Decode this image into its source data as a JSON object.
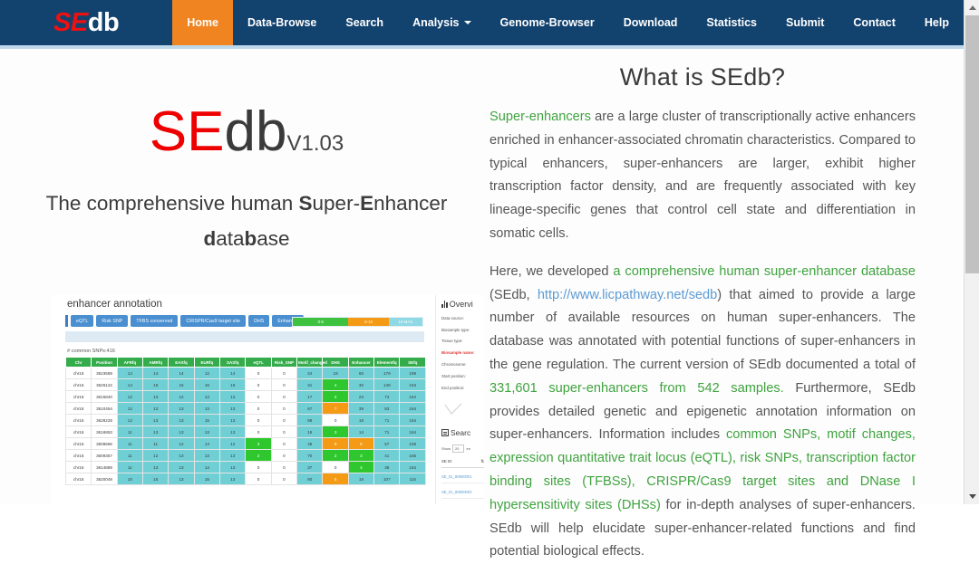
{
  "navbar": {
    "logo": {
      "part1": "SE",
      "part2": "db"
    },
    "items": [
      {
        "label": "Home",
        "active": true,
        "caret": false
      },
      {
        "label": "Data-Browse",
        "active": false,
        "caret": false
      },
      {
        "label": "Search",
        "active": false,
        "caret": false
      },
      {
        "label": "Analysis",
        "active": false,
        "caret": true
      },
      {
        "label": "Genome-Browser",
        "active": false,
        "caret": false
      },
      {
        "label": "Download",
        "active": false,
        "caret": false
      },
      {
        "label": "Statistics",
        "active": false,
        "caret": false
      },
      {
        "label": "Submit",
        "active": false,
        "caret": false
      },
      {
        "label": "Contact",
        "active": false,
        "caret": false
      },
      {
        "label": "Help",
        "active": false,
        "caret": false
      }
    ]
  },
  "brand": {
    "se": "SE",
    "db": "db",
    "version": "V1.03",
    "tagline_line1_a": "The comprehensive human ",
    "tagline_line1_b": "S",
    "tagline_line1_c": "uper-",
    "tagline_line1_d": "E",
    "tagline_line1_e": "nhancer",
    "tagline_line2_a": "d",
    "tagline_line2_b": "ata",
    "tagline_line2_c": "b",
    "tagline_line2_d": "ase"
  },
  "screenshot": {
    "heading": "enhancer annotation",
    "tabs": [
      "eQTL",
      "Risk SNP",
      "TFBS conserved",
      "CRISPR/Cas9 target site",
      "DHS",
      "Enhancer"
    ],
    "legend": [
      "0-5",
      "5-10",
      "10-MAX"
    ],
    "note": "# common SNPs:416",
    "table_headers": [
      "Chr",
      "Position",
      "AFRfq",
      "AMRfq",
      "EASfq",
      "EURfq",
      "SASfq",
      "eQTL",
      "Risk_SNP",
      "Motif_changed",
      "DHS",
      "Enhancer",
      "Elementfq",
      "SEfq"
    ],
    "table_rows": [
      [
        "chr16",
        "3623589",
        "14",
        "14",
        "14",
        "12",
        "14",
        "0",
        "0",
        "24",
        "19",
        "60",
        "179",
        "199"
      ],
      [
        "chr16",
        "3626122",
        "14",
        "16",
        "15",
        "16",
        "16",
        "0",
        "0",
        "31",
        "4",
        "30",
        "149",
        "153"
      ],
      [
        "chr16",
        "3615840",
        "12",
        "13",
        "12",
        "14",
        "13",
        "0",
        "0",
        "17",
        "4",
        "23",
        "74",
        "164"
      ],
      [
        "chr16",
        "3610454",
        "12",
        "13",
        "13",
        "13",
        "13",
        "0",
        "0",
        "67",
        "7",
        "39",
        "83",
        "164"
      ],
      [
        "chr16",
        "3628228",
        "12",
        "13",
        "13",
        "15",
        "13",
        "0",
        "0",
        "88",
        "0",
        "18",
        "71",
        "164"
      ],
      [
        "chr16",
        "3616853",
        "11",
        "13",
        "13",
        "13",
        "13",
        "0",
        "0",
        "19",
        "3",
        "14",
        "71",
        "164"
      ],
      [
        "chr16",
        "3608686",
        "11",
        "11",
        "12",
        "14",
        "12",
        "3",
        "0",
        "48",
        "9",
        "6",
        "57",
        "169"
      ],
      [
        "chr16",
        "3609357",
        "11",
        "12",
        "13",
        "13",
        "13",
        "2",
        "0",
        "70",
        "2",
        "3",
        "41",
        "166"
      ],
      [
        "chr16",
        "3614889",
        "11",
        "13",
        "13",
        "14",
        "13",
        "0",
        "0",
        "37",
        "0",
        "4",
        "38",
        "164"
      ],
      [
        "chr16",
        "3620049",
        "10",
        "15",
        "13",
        "15",
        "13",
        "0",
        "0",
        "80",
        "5",
        "18",
        "107",
        "116"
      ]
    ],
    "sidebar": {
      "overview_title": "Overvi",
      "fields": [
        "Data source:",
        "Biosample type:",
        "Tissue type:",
        "Biosample name:",
        "Chromosome:",
        "Start position:",
        "End position:"
      ],
      "search_title": "Searc",
      "show_label": "Show",
      "show_value": "20",
      "show_suffix": "en",
      "seid_header": "SE ID",
      "seids": [
        "SE_01_80900001",
        "SE_01_80900002"
      ]
    }
  },
  "main": {
    "title": "What is SEdb?",
    "paragraph1": [
      {
        "t": "Super-enhancers",
        "s": "grn"
      },
      {
        "t": " are a large cluster of transcriptionally active enhancers enriched in enhancer-associated chromatin characteristics. Compared to typical enhancers, super-enhancers are larger, exhibit higher transcription factor density, and are frequently associated with key lineage-specific genes that control cell state and differentiation in somatic cells.",
        "s": ""
      }
    ],
    "paragraph2": [
      {
        "t": "Here, we developed ",
        "s": ""
      },
      {
        "t": "a comprehensive human super-enhancer database",
        "s": "grn"
      },
      {
        "t": " (SEdb, ",
        "s": ""
      },
      {
        "t": "http://www.licpathway.net/sedb",
        "s": "lnk"
      },
      {
        "t": ") that aimed to provide a large number of available resources on human super-enhancers. The database was annotated with potential functions of super-enhancers in the gene regulation. The current version of SEdb documented a total of ",
        "s": ""
      },
      {
        "t": "331,601 super-enhancers from 542 samples.",
        "s": "grn"
      },
      {
        "t": " Furthermore, SEdb provides detailed genetic and epigenetic annotation information on super-enhancers. Information includes ",
        "s": ""
      },
      {
        "t": "common SNPs, motif changes, expression quantitative trait locus (eQTL), risk SNPs, transcription factor binding sites (TFBSs), CRISPR/Cas9 target sites and DNase I hypersensitivity sites (DHSs)",
        "s": "grn"
      },
      {
        "t": " for in-depth analyses of super-enhancers. SEdb will help elucidate super-enhancer-related functions and find potential biological effects.",
        "s": ""
      }
    ]
  },
  "colors": {
    "navbar_bg": "#12426e",
    "nav_active": "#ef8421",
    "accent_green": "#3fa33f",
    "link_blue": "#5b9bd5",
    "brand_red": "#ef0000"
  }
}
